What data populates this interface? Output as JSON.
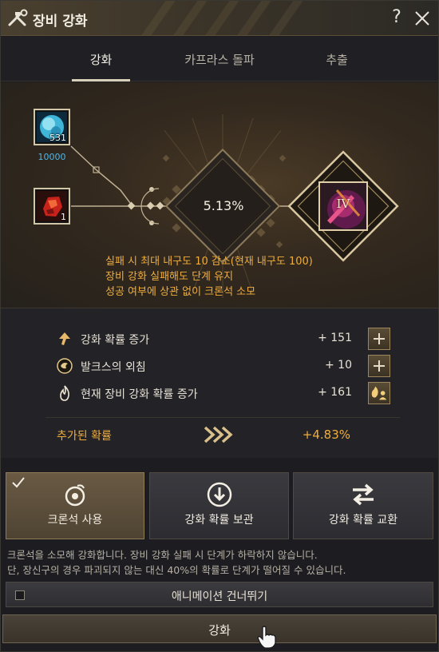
{
  "window": {
    "title": "장비 강화",
    "help_symbol": "?"
  },
  "tabs": [
    {
      "label": "강화",
      "active": true
    },
    {
      "label": "카프라스 돌파",
      "active": false
    },
    {
      "label": "추출",
      "active": false
    }
  ],
  "materials": [
    {
      "icon": "crystal-orb-icon",
      "count": "531",
      "cost": "10000"
    },
    {
      "icon": "red-stone-icon",
      "count": "1"
    }
  ],
  "enhance": {
    "success_rate": "5.13%",
    "target_level": "IV",
    "notes": [
      "실패 시 최대 내구도 10 감소(현재 내구도 100)",
      "장비 강화 실패해도 단계 유지",
      "성공 여부에 상관 없이 크론석 소모"
    ]
  },
  "bonuses": [
    {
      "icon": "up-arrow-icon",
      "label": "강화 확률 증가",
      "value": "+ 151"
    },
    {
      "icon": "swirl-orb-icon",
      "label": "발크스의 외침",
      "value": "+ 10"
    },
    {
      "icon": "flame-icon",
      "label": "현재 장비 강화 확률 증가",
      "value": "+ 161"
    }
  ],
  "added_rate": {
    "label": "추가된 확률",
    "value": "+4.83%"
  },
  "options": [
    {
      "label": "크론석 사용",
      "icon": "cron-stone-icon",
      "selected": true
    },
    {
      "label": "강화 확률 보관",
      "icon": "store-down-icon",
      "selected": false
    },
    {
      "label": "강화 확률 교환",
      "icon": "exchange-arrows-icon",
      "selected": false
    }
  ],
  "description": [
    "크론석을 소모해 강화합니다. 장비 강화 실패 시 단계가 하락하지 않습니다.",
    "단, 장신구의 경우 파괴되지 않는 대신 40%의 확률로 단계가 떨어질 수 있습니다."
  ],
  "skip_animation": {
    "label": "애니메이션 건너뛰기",
    "checked": false
  },
  "enhance_button": {
    "label": "강화"
  },
  "colors": {
    "accent_orange": "#f1ad3b",
    "cost_blue": "#4ab8e8",
    "gold_frame": "#d2c6a8"
  }
}
